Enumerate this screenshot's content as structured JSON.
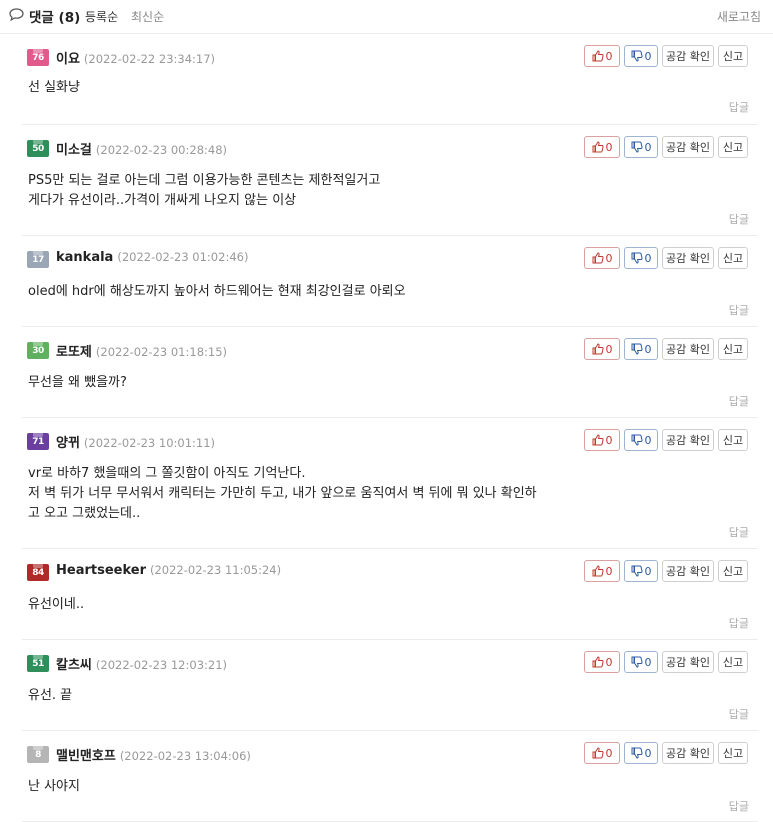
{
  "header": {
    "title": "댓글 (8)",
    "sort_options": [
      "등록순",
      "최신순"
    ],
    "refresh_label": "새로고침"
  },
  "actions": {
    "agree_label": "공감 확인",
    "report_label": "신고",
    "reply_label": "답글"
  },
  "comments": [
    {
      "level": "76",
      "level_color": "#e05a8c",
      "author": "이요",
      "date": "(2022-02-22 23:34:17)",
      "lines": [
        "선 실화냥"
      ],
      "likes": "0",
      "dislikes": "0"
    },
    {
      "level": "50",
      "level_color": "#2f8f5a",
      "author": "미소걸",
      "date": "(2022-02-23 00:28:48)",
      "lines": [
        "PS5만 되는 걸로 아는데 그럼 이용가능한 콘텐츠는 제한적일거고",
        "게다가 유선이라..가격이 개싸게 나오지 않는 이상"
      ],
      "likes": "0",
      "dislikes": "0"
    },
    {
      "level": "17",
      "level_color": "#9aa5b5",
      "author": "kankala",
      "date": "(2022-02-23 01:02:46)",
      "lines": [
        "oled에 hdr에 해상도까지 높아서 하드웨어는 현재 최강인걸로 아뢰오"
      ],
      "likes": "0",
      "dislikes": "0"
    },
    {
      "level": "30",
      "level_color": "#5fb05f",
      "author": "로또제",
      "date": "(2022-02-23 01:18:15)",
      "lines": [
        "무선을 왜 뺐을까?"
      ],
      "likes": "0",
      "dislikes": "0"
    },
    {
      "level": "71",
      "level_color": "#6b3fa0",
      "author": "양뀌",
      "date": "(2022-02-23 10:01:11)",
      "lines": [
        "vr로 바하7 했을때의 그 쫄깃함이 아직도 기억난다.",
        "저 벽 뒤가 너무 무서워서 캐릭터는 가만히 두고, 내가 앞으로 움직여서 벽 뒤에 뭐 있나 확인하",
        "고 오고 그랬었는데.."
      ],
      "likes": "0",
      "dislikes": "0"
    },
    {
      "level": "84",
      "level_color": "#b02a2a",
      "author": "Heartseeker",
      "date": "(2022-02-23 11:05:24)",
      "lines": [
        "유선이네.."
      ],
      "likes": "0",
      "dislikes": "0"
    },
    {
      "level": "51",
      "level_color": "#2f8f5a",
      "author": "칼츠씨",
      "date": "(2022-02-23 12:03:21)",
      "lines": [
        "유선. 끝"
      ],
      "likes": "0",
      "dislikes": "0"
    },
    {
      "level": "8",
      "level_color": "#b5b5b5",
      "author": "맬빈맨호프",
      "date": "(2022-02-23 13:04:06)",
      "lines": [
        "난 사야지"
      ],
      "likes": "0",
      "dislikes": "0"
    }
  ]
}
